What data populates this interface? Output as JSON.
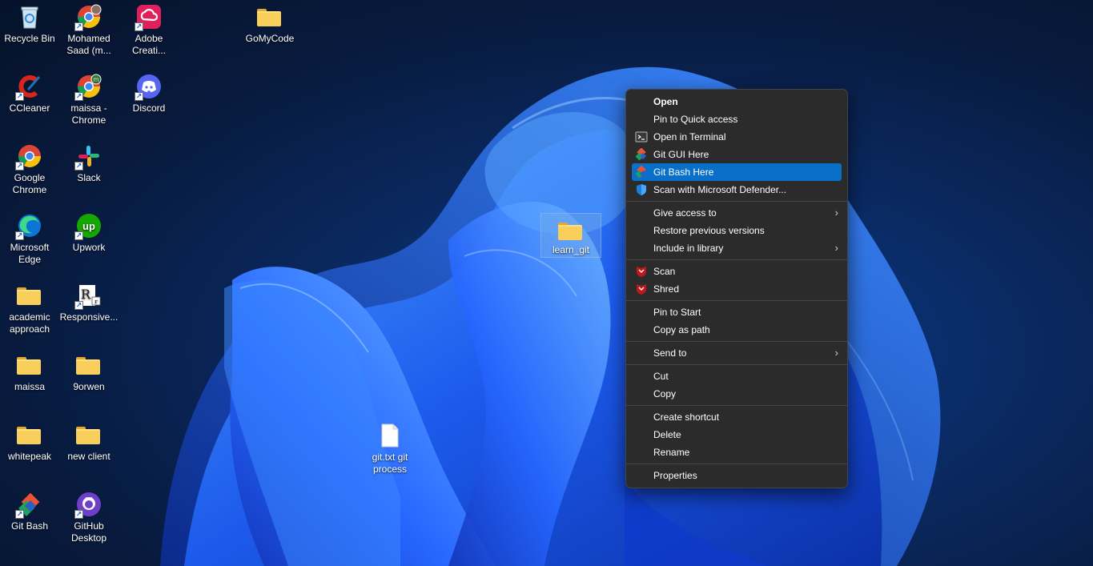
{
  "desktop": {
    "icons": [
      {
        "label": "Recycle Bin"
      },
      {
        "label": "Mohamed Saad (m..."
      },
      {
        "label": "Adobe Creati..."
      },
      {
        "label": "GoMyCode"
      },
      {
        "label": "CCleaner"
      },
      {
        "label": "maissa - Chrome"
      },
      {
        "label": "Discord"
      },
      {
        "label": "Google Chrome"
      },
      {
        "label": "Slack"
      },
      {
        "label": "Microsoft Edge"
      },
      {
        "label": "Upwork"
      },
      {
        "label": "academic approach"
      },
      {
        "label": "Responsive..."
      },
      {
        "label": "maissa"
      },
      {
        "label": "9orwen"
      },
      {
        "label": "whitepeak"
      },
      {
        "label": "new client"
      },
      {
        "label": "Git Bash"
      },
      {
        "label": "GitHub Desktop"
      },
      {
        "label": "learn_git"
      },
      {
        "label": "git.txt git process"
      }
    ]
  },
  "context_menu": {
    "items": [
      {
        "label": "Open"
      },
      {
        "label": "Pin to Quick access"
      },
      {
        "label": "Open in Terminal"
      },
      {
        "label": "Git GUI Here"
      },
      {
        "label": "Git Bash Here"
      },
      {
        "label": "Scan with Microsoft Defender..."
      },
      {
        "label": "Give access to"
      },
      {
        "label": "Restore previous versions"
      },
      {
        "label": "Include in library"
      },
      {
        "label": "Scan"
      },
      {
        "label": "Shred"
      },
      {
        "label": "Pin to Start"
      },
      {
        "label": "Copy as path"
      },
      {
        "label": "Send to"
      },
      {
        "label": "Cut"
      },
      {
        "label": "Copy"
      },
      {
        "label": "Create shortcut"
      },
      {
        "label": "Delete"
      },
      {
        "label": "Rename"
      },
      {
        "label": "Properties"
      }
    ],
    "highlight_color": "#0a6fc9"
  }
}
